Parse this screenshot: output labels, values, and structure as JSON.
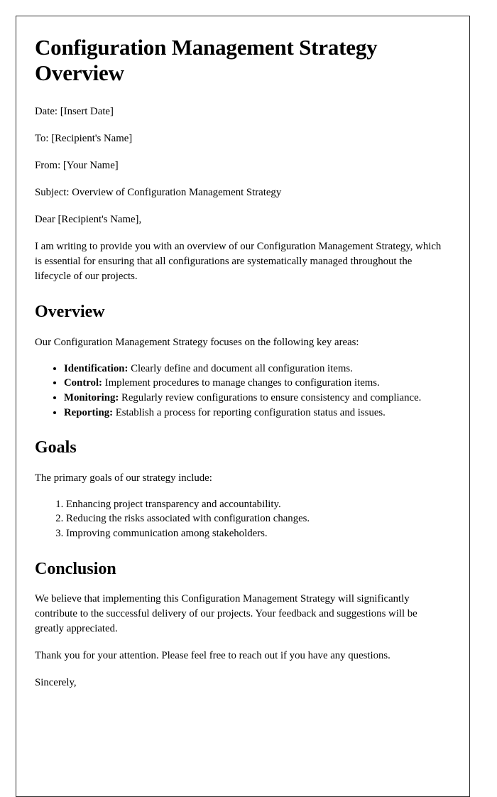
{
  "document": {
    "title": "Configuration Management Strategy Overview",
    "header_fields": [
      "Date: [Insert Date]",
      "To: [Recipient's Name]",
      "From: [Your Name]",
      "Subject: Overview of Configuration Management Strategy"
    ],
    "salutation": "Dear [Recipient's Name],",
    "intro_paragraph": "I am writing to provide you with an overview of our Configuration Management Strategy, which is essential for ensuring that all configurations are systematically managed throughout the lifecycle of our projects.",
    "sections": {
      "overview": {
        "heading": "Overview",
        "lead_in": "Our Configuration Management Strategy focuses on the following key areas:",
        "items": [
          {
            "term": "Identification:",
            "text": " Clearly define and document all configuration items."
          },
          {
            "term": "Control:",
            "text": " Implement procedures to manage changes to configuration items."
          },
          {
            "term": "Monitoring:",
            "text": " Regularly review configurations to ensure consistency and compliance."
          },
          {
            "term": "Reporting:",
            "text": " Establish a process for reporting configuration status and issues."
          }
        ]
      },
      "goals": {
        "heading": "Goals",
        "lead_in": "The primary goals of our strategy include:",
        "items": [
          "Enhancing project transparency and accountability.",
          "Reducing the risks associated with configuration changes.",
          "Improving communication among stakeholders."
        ]
      },
      "conclusion": {
        "heading": "Conclusion",
        "paragraph_1": "We believe that implementing this Configuration Management Strategy will significantly contribute to the successful delivery of our projects. Your feedback and suggestions will be greatly appreciated.",
        "paragraph_2": "Thank you for your attention. Please feel free to reach out if you have any questions.",
        "closing": "Sincerely,"
      }
    }
  }
}
